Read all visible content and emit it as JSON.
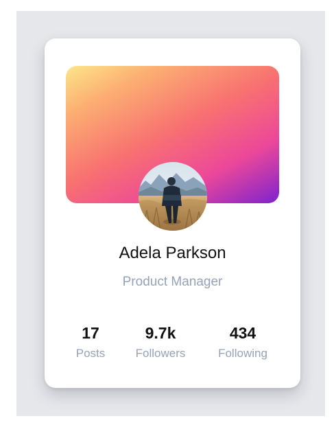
{
  "profile": {
    "name": "Adela Parkson",
    "role": "Product Manager",
    "avatar_icon": "profile-photo"
  },
  "stats": {
    "posts": {
      "value": "17",
      "label": "Posts"
    },
    "followers": {
      "value": "9.7k",
      "label": "Followers"
    },
    "following": {
      "value": "434",
      "label": "Following"
    }
  },
  "colors": {
    "page_background": "#e5e7eb",
    "card_background": "#ffffff",
    "gradient": [
      "#fde68a",
      "#fcae72",
      "#f87171",
      "#ec4899",
      "#7e22ce"
    ],
    "primary_text": "#111111",
    "secondary_text": "#94a3b8"
  }
}
